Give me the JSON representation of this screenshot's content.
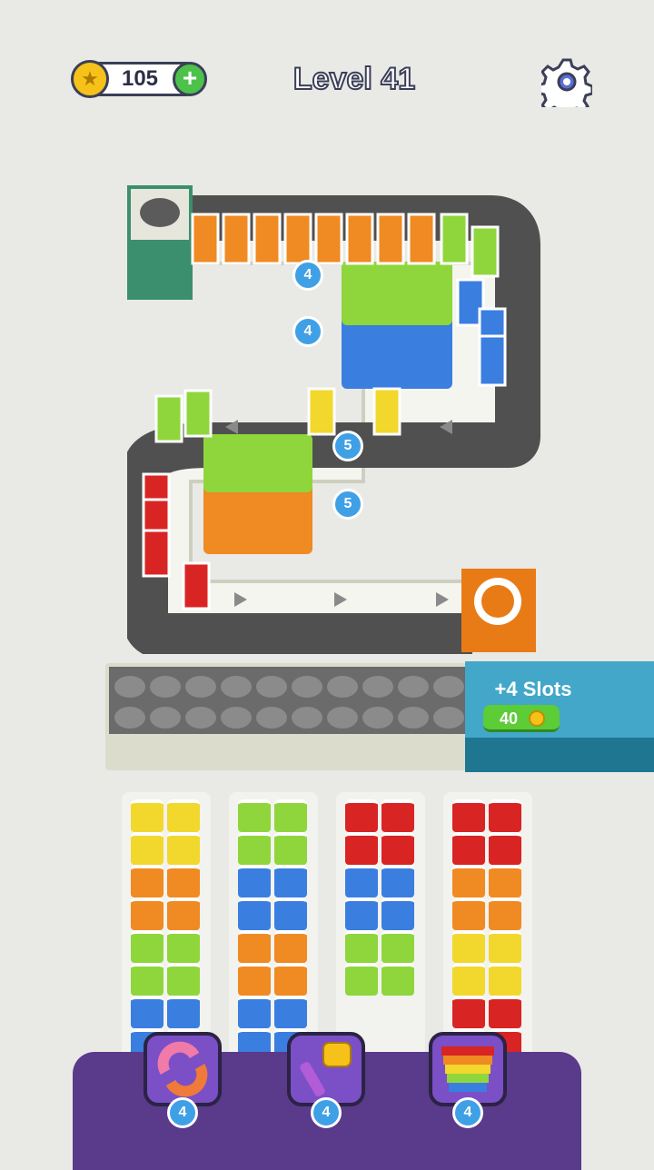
{
  "header": {
    "coins": "105",
    "level": "Level 41"
  },
  "board": {
    "cup_counters": [
      "4",
      "4",
      "5",
      "5"
    ]
  },
  "slots": {
    "label": "+4 Slots",
    "price": "40"
  },
  "boosters": [
    {
      "name": "shuffle",
      "count": "4"
    },
    {
      "name": "hammer",
      "count": "4"
    },
    {
      "name": "rainbow-cups",
      "count": "4"
    }
  ],
  "colors": {
    "orange": "#f08a22",
    "green": "#8fd63c",
    "blue": "#3a7ee0",
    "red": "#d92424",
    "yellow": "#f2d72c",
    "purple": "#5a3a8a"
  },
  "columns": [
    [
      "yellow",
      "yellow",
      "yellow",
      "yellow",
      "orange",
      "orange",
      "orange",
      "orange",
      "green",
      "green",
      "green",
      "green",
      "blue",
      "blue",
      "blue",
      "blue"
    ],
    [
      "green",
      "green",
      "green",
      "green",
      "blue",
      "blue",
      "blue",
      "blue",
      "orange",
      "orange",
      "orange",
      "orange",
      "blue",
      "blue",
      "blue",
      "blue"
    ],
    [
      "red",
      "red",
      "red",
      "red",
      "blue",
      "blue",
      "blue",
      "blue",
      "green",
      "green",
      "green",
      "green"
    ],
    [
      "red",
      "red",
      "red",
      "red",
      "orange",
      "orange",
      "orange",
      "orange",
      "yellow",
      "yellow",
      "yellow",
      "yellow",
      "red",
      "red",
      "red",
      "red"
    ]
  ]
}
